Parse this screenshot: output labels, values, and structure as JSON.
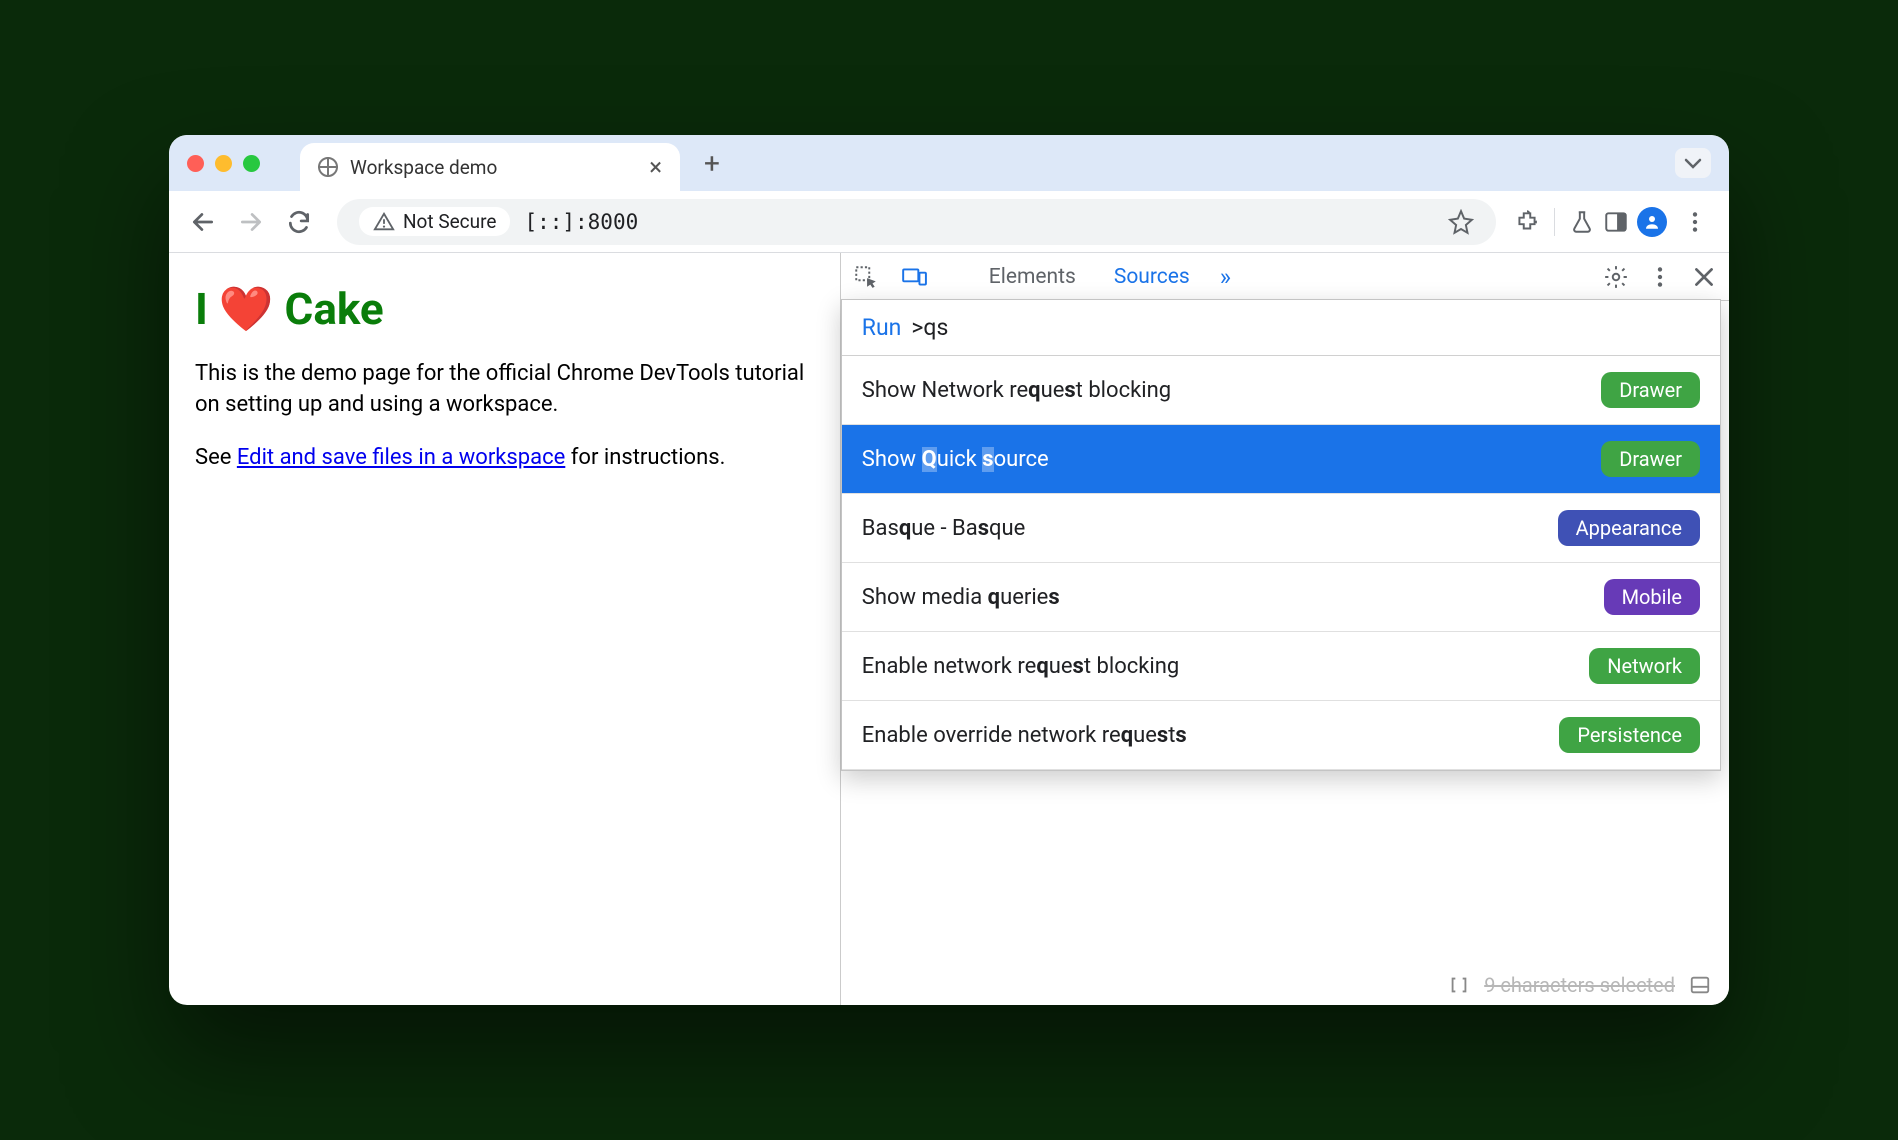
{
  "window": {
    "tab_title": "Workspace demo"
  },
  "omnibox": {
    "security_label": "Not Secure",
    "url": "[::]:8000"
  },
  "page": {
    "heading": "I ❤️ Cake",
    "paragraph1": "This is the demo page for the official Chrome DevTools tutorial on setting up and using a workspace.",
    "see_prefix": "See ",
    "link_text": "Edit and save files in a workspace",
    "see_suffix": " for instructions."
  },
  "devtools": {
    "tabs": {
      "elements": "Elements",
      "sources": "Sources"
    },
    "command": {
      "prefix": "Run",
      "query": ">qs"
    },
    "items": [
      {
        "label_html": "Show Network re<b class='hl'>q</b>ue<b class='hl'>s</b>t blocking",
        "badge": "Drawer",
        "badge_color": "#3fa444",
        "selected": false
      },
      {
        "label_html": "Show <b class='hl'>Q</b>uick <b class='hl'>s</b>ource",
        "badge": "Drawer",
        "badge_color": "#3fa444",
        "selected": true
      },
      {
        "label_html": "Bas<b class='hl'>q</b>ue - Ba<b class='hl'>s</b>que",
        "badge": "Appearance",
        "badge_color": "#3f51b5",
        "selected": false
      },
      {
        "label_html": "Show media <b class='hl'>q</b>uerie<b class='hl'>s</b>",
        "badge": "Mobile",
        "badge_color": "#673ab7",
        "selected": false
      },
      {
        "label_html": "Enable network re<b class='hl'>q</b>ue<b class='hl'>s</b>t blocking",
        "badge": "Network",
        "badge_color": "#3fa444",
        "selected": false
      },
      {
        "label_html": "Enable override network re<b class='hl'>q</b>ue<b class='hl'>s</b>t<b class='hl'>s</b>",
        "badge": "Persistence",
        "badge_color": "#3fa444",
        "selected": false
      }
    ],
    "status": "9 characters selected"
  }
}
